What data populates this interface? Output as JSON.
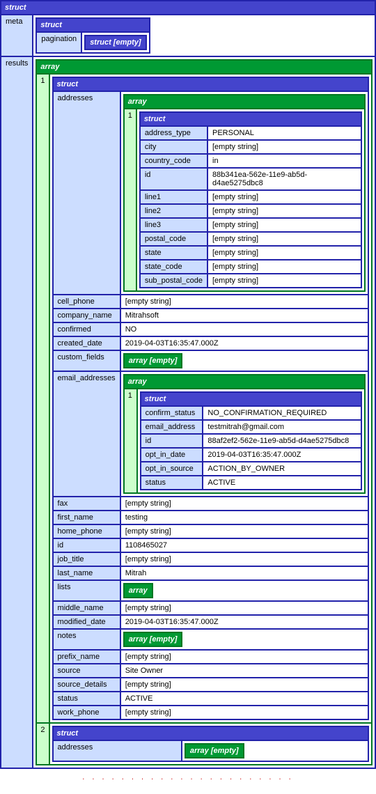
{
  "labels": {
    "struct": "struct",
    "array": "array",
    "struct_empty": "struct [empty]",
    "array_empty": "array [empty]",
    "empty_string": "[empty string]"
  },
  "root": {
    "meta": {
      "pagination": {}
    },
    "results": [
      {
        "addresses": [
          {
            "address_type": "PERSONAL",
            "city": "[empty string]",
            "country_code": "in",
            "id": "88b341ea-562e-11e9-ab5d-d4ae5275dbc8",
            "line1": "[empty string]",
            "line2": "[empty string]",
            "line3": "[empty string]",
            "postal_code": "[empty string]",
            "state": "[empty string]",
            "state_code": "[empty string]",
            "sub_postal_code": "[empty string]"
          }
        ],
        "cell_phone": "[empty string]",
        "company_name": "Mitrahsoft",
        "confirmed": "NO",
        "created_date": "2019-04-03T16:35:47.000Z",
        "custom_fields": [],
        "email_addresses": [
          {
            "confirm_status": "NO_CONFIRMATION_REQUIRED",
            "email_address": "testmitrah@gmail.com",
            "id": "88af2ef2-562e-11e9-ab5d-d4ae5275dbc8",
            "opt_in_date": "2019-04-03T16:35:47.000Z",
            "opt_in_source": "ACTION_BY_OWNER",
            "status": "ACTIVE"
          }
        ],
        "fax": "[empty string]",
        "first_name": "testing",
        "home_phone": "[empty string]",
        "id": "1108465027",
        "job_title": "[empty string]",
        "last_name": "Mitrah",
        "lists": [],
        "middle_name": "[empty string]",
        "modified_date": "2019-04-03T16:35:47.000Z",
        "notes": [],
        "prefix_name": "[empty string]",
        "source": "Site Owner",
        "source_details": "[empty string]",
        "status": "ACTIVE",
        "work_phone": "[empty string]"
      },
      {
        "addresses": []
      }
    ]
  },
  "keys": {
    "meta": "meta",
    "pagination": "pagination",
    "results": "results",
    "addresses": "addresses",
    "address_type": "address_type",
    "city": "city",
    "country_code": "country_code",
    "id": "id",
    "line1": "line1",
    "line2": "line2",
    "line3": "line3",
    "postal_code": "postal_code",
    "state": "state",
    "state_code": "state_code",
    "sub_postal_code": "sub_postal_code",
    "cell_phone": "cell_phone",
    "company_name": "company_name",
    "confirmed": "confirmed",
    "created_date": "created_date",
    "custom_fields": "custom_fields",
    "email_addresses": "email_addresses",
    "confirm_status": "confirm_status",
    "email_address": "email_address",
    "opt_in_date": "opt_in_date",
    "opt_in_source": "opt_in_source",
    "status": "status",
    "fax": "fax",
    "first_name": "first_name",
    "home_phone": "home_phone",
    "job_title": "job_title",
    "last_name": "last_name",
    "lists": "lists",
    "middle_name": "middle_name",
    "modified_date": "modified_date",
    "notes": "notes",
    "prefix_name": "prefix_name",
    "source": "source",
    "source_details": "source_details",
    "work_phone": "work_phone"
  },
  "idx": {
    "one": "1",
    "two": "2"
  },
  "dots": ". . . . . . . . . . . . . . . . . . . . . ."
}
